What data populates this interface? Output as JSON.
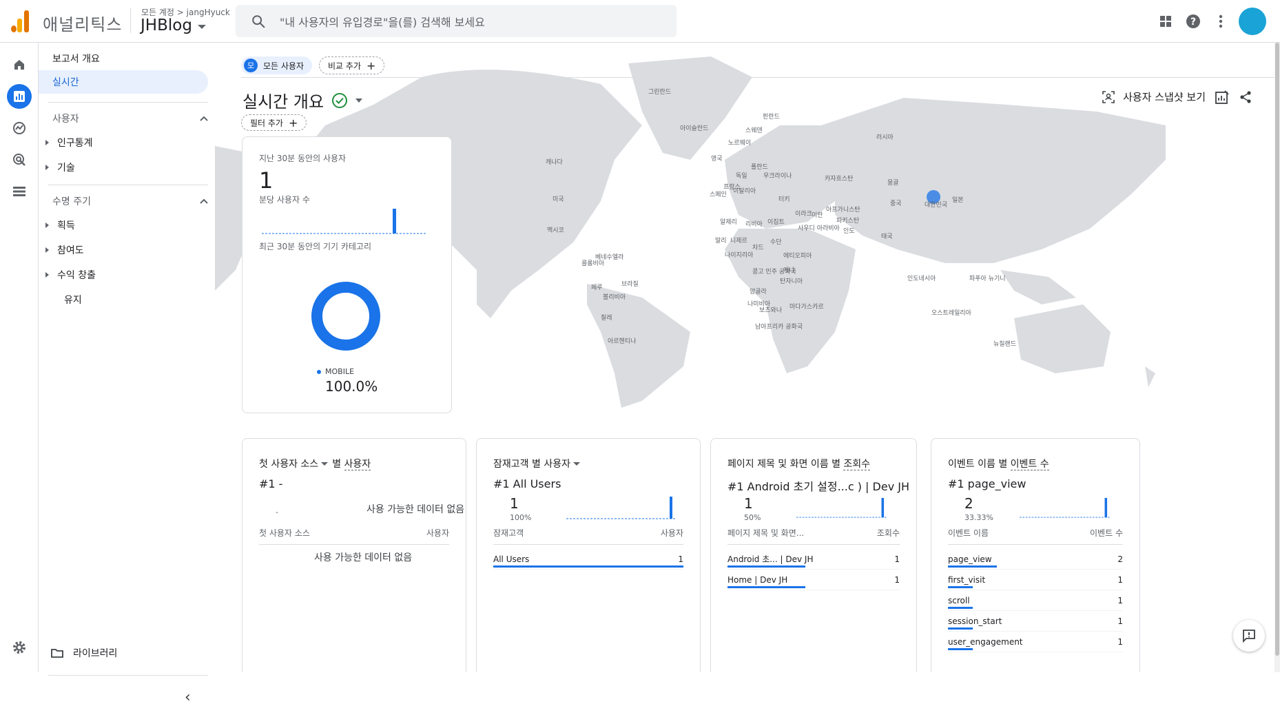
{
  "topbar": {
    "app_name": "애널리틱스",
    "account_path": "모든 계정 > jangHyuck",
    "property_name": "JHBlog",
    "search_placeholder": "\"내 사용자의 유입경로\"을(를) 검색해 보세요",
    "icons": [
      "apps-grid-icon",
      "help-icon",
      "more-vert-icon",
      "account-avatar"
    ]
  },
  "rail": {
    "icons": [
      "home-icon",
      "reports-icon",
      "explore-icon",
      "advertising-icon",
      "configure-icon",
      "settings-icon"
    ]
  },
  "nav": {
    "overview": "보고서 개요",
    "realtime": "실시간",
    "user_section": "사용자",
    "user_items": [
      "인구통계",
      "기술"
    ],
    "lifecycle_section": "수명 주기",
    "lifecycle_items": [
      "획득",
      "참여도",
      "수익 창출"
    ],
    "retention": "유지",
    "library": "라이브러리"
  },
  "main": {
    "chip_all_users_initial": "모",
    "chip_all_users": "모든 사용자",
    "chip_compare": "비교 추가",
    "title": "실시간 개요",
    "filter": "필터 추가",
    "snapshot": "사용자 스냅샷 보기"
  },
  "map_labels": [
    "그린란드",
    "아이슬란드",
    "핀란드",
    "스웨덴",
    "노르웨이",
    "영국",
    "폴란드",
    "독일",
    "우크라이나",
    "프랑스",
    "이탈리아",
    "스페인",
    "러시아",
    "카자흐스탄",
    "몽골",
    "중국",
    "일본",
    "대한민국",
    "캐나다",
    "미국",
    "멕시코",
    "베네수엘라",
    "콜롬비아",
    "페루",
    "브라질",
    "볼리비아",
    "칠레",
    "아르헨티나",
    "알제리",
    "리비아",
    "이집트",
    "말리",
    "니제르",
    "차드",
    "수단",
    "나이지리아",
    "에티오피아",
    "콩고 민주 공화국",
    "케냐",
    "탄자니아",
    "앙골라",
    "나미비아",
    "보츠와나",
    "마다가스카르",
    "남아프리카 공화국",
    "터키",
    "이라크",
    "이란",
    "사우디 아라비아",
    "아프가니스탄",
    "파키스탄",
    "인도",
    "태국",
    "인도네시아",
    "파푸아 뉴기니",
    "오스트레일리아",
    "뉴질랜드"
  ],
  "realtime_card": {
    "users_label": "지난 30분 동안의 사용자",
    "users_value": "1",
    "per_minute_label": "분당 사용자 수",
    "device_label": "최근 30분 동안의 기기 카테고리",
    "legend": "MOBILE",
    "percent": "100.0%"
  },
  "cards": {
    "source": {
      "title_a": "첫 사용자 소스",
      "title_b": "별",
      "title_c": "사용자",
      "rank": "#1  -",
      "dash": "-",
      "nodata": "사용 가능한 데이터 없음",
      "col1": "첫 사용자 소스",
      "col2": "사용자",
      "nodata2": "사용 가능한 데이터 없음"
    },
    "audience": {
      "title_a": "잠재고객",
      "title_b": "별",
      "title_c": "사용자",
      "rank": "#1  All Users",
      "value": "1",
      "pct": "100%",
      "col1": "잠재고객",
      "col2": "사용자",
      "rows": [
        {
          "name": "All Users",
          "value": "1"
        }
      ]
    },
    "pages": {
      "title_a": "페이지 제목 및 화면 이름",
      "title_b": "별",
      "title_c": "조회수",
      "rank": "#1  Android 초기 설정...c ) | Dev JH",
      "value": "1",
      "pct": "50%",
      "col1": "페이지 제목 및 화면...",
      "col2": "조회수",
      "rows": [
        {
          "name": "Android 초... | Dev JH",
          "value": "1"
        },
        {
          "name": "Home | Dev JH",
          "value": "1"
        }
      ]
    },
    "events": {
      "title_a": "이벤트 이름",
      "title_b": "별",
      "title_c": "이벤트 수",
      "rank": "#1  page_view",
      "value": "2",
      "pct": "33.33%",
      "col1": "이벤트 이름",
      "col2": "이벤트 수",
      "rows": [
        {
          "name": "page_view",
          "value": "2"
        },
        {
          "name": "first_visit",
          "value": "1"
        },
        {
          "name": "scroll",
          "value": "1"
        },
        {
          "name": "session_start",
          "value": "1"
        },
        {
          "name": "user_engagement",
          "value": "1"
        }
      ]
    }
  },
  "colors": {
    "accent": "#1a73e8",
    "map_land": "#dadce0",
    "logo_orange": "#f9ab00",
    "logo_dark": "#e37400"
  }
}
